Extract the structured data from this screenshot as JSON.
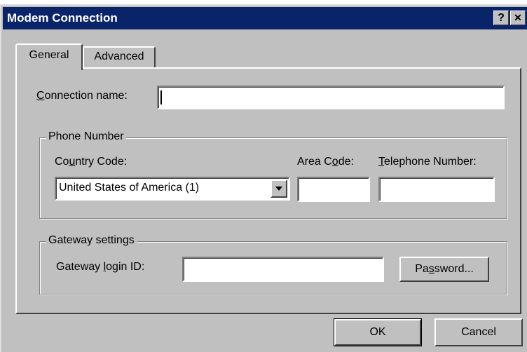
{
  "window": {
    "title": "Modem Connection",
    "help_glyph": "?",
    "close_glyph": "✕"
  },
  "tabs": [
    {
      "label": "General",
      "selected": true
    },
    {
      "label": "Advanced",
      "selected": false
    }
  ],
  "connection": {
    "label_pre": "",
    "label_key": "C",
    "label_post": "onnection name:",
    "value": ""
  },
  "phone": {
    "legend": "Phone Number",
    "country_label_pre": "Co",
    "country_label_key": "u",
    "country_label_post": "ntry Code:",
    "country_value": "United States of America (1)",
    "area_label_pre": "Area C",
    "area_label_key": "o",
    "area_label_post": "de:",
    "area_value": "",
    "tel_label_pre": "",
    "tel_label_key": "T",
    "tel_label_post": "elephone Number:",
    "tel_value": ""
  },
  "gateway": {
    "legend": "Gateway settings",
    "login_label_pre": "Gateway ",
    "login_label_key": "l",
    "login_label_post": "ogin ID:",
    "login_value": "",
    "password_pre": "Pa",
    "password_key": "s",
    "password_post": "sword..."
  },
  "footer": {
    "ok_label": "OK",
    "cancel_label": "Cancel"
  }
}
